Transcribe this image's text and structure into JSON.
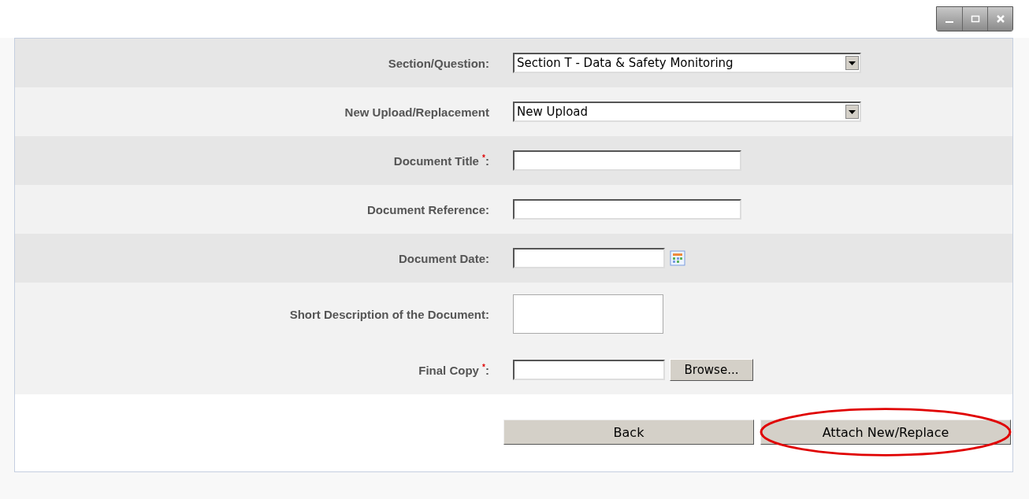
{
  "window_controls": [
    {
      "kind": "minimize"
    },
    {
      "kind": "maximize"
    },
    {
      "kind": "close"
    }
  ],
  "rows": [
    {
      "label": "Section/Question:",
      "kind": "select",
      "value": "Section T - Data & Safety Monitoring",
      "shaded": true
    },
    {
      "label": "New Upload/Replacement",
      "kind": "select",
      "value": "New Upload",
      "shaded": false
    },
    {
      "label": "Document Title $^{*}$:",
      "kind": "text",
      "shaded": true
    },
    {
      "label": "Document Reference:",
      "kind": "text",
      "shaded": false
    },
    {
      "label": "Document Date:",
      "kind": "date",
      "shaded": true
    },
    {
      "label": "Short Description of the Document:",
      "kind": "textarea",
      "shaded": false
    },
    {
      "label": "Final Copy $^{*}$:",
      "kind": "file",
      "button": "Browse...",
      "shaded": false
    }
  ],
  "buttons": [
    {
      "label": "Back",
      "highlighted": false
    },
    {
      "label": "Attach New/Replace",
      "highlighted": true
    }
  ]
}
